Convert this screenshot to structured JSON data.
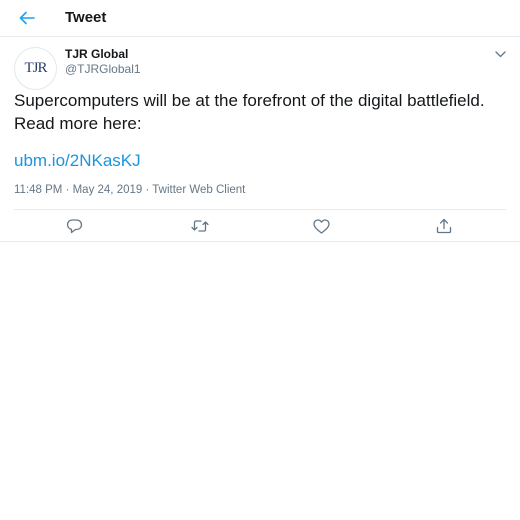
{
  "header": {
    "back_icon": "arrow-left-icon",
    "title": "Tweet"
  },
  "tweet": {
    "avatar_text": "TJR",
    "display_name": "TJR Global",
    "handle": "@TJRGlobal1",
    "text": "Supercomputers will be at the forefront of the digital battlefield.  Read more here:",
    "link": "ubm.io/2NKasKJ",
    "meta": "11:48 PM · May 24, 2019 · Twitter Web Client"
  },
  "actions": [
    "reply-icon",
    "retweet-icon",
    "like-icon",
    "share-icon"
  ],
  "colors": {
    "accent": "#1da1f2",
    "link": "#1b95e0",
    "secondary_text": "#657786",
    "divider": "#e6ecf0"
  }
}
